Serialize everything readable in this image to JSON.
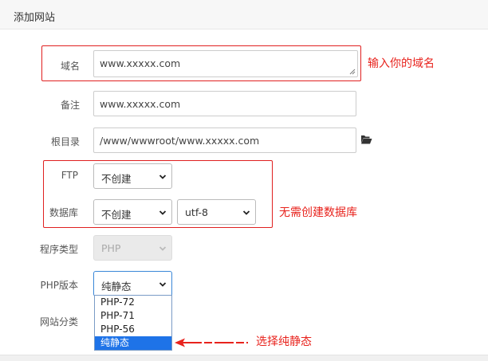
{
  "header": {
    "title": "添加网站"
  },
  "form": {
    "domain": {
      "label": "域名",
      "value": "www.xxxxx.com"
    },
    "remark": {
      "label": "备注",
      "value": "www.xxxxx.com"
    },
    "root": {
      "label": "根目录",
      "value": "/www/wwwroot/www.xxxxx.com",
      "icon": "folder-open-icon"
    },
    "ftp": {
      "label": "FTP",
      "value": "不创建"
    },
    "database": {
      "label": "数据库",
      "value": "不创建",
      "charset": "utf-8"
    },
    "program_type": {
      "label": "程序类型",
      "value": "PHP"
    },
    "php_version": {
      "label": "PHP版本",
      "value": "纯静态",
      "options": [
        "PHP-72",
        "PHP-71",
        "PHP-56",
        "纯静态"
      ]
    },
    "site_category": {
      "label": "网站分类"
    }
  },
  "annotations": {
    "domain_hint": "输入你的域名",
    "database_hint": "无需创建数据库",
    "static_hint": "选择纯静态"
  },
  "colors": {
    "annotation": "#e8231d",
    "selected_option": "#1e73e8",
    "border_focus": "#3a87d8"
  }
}
